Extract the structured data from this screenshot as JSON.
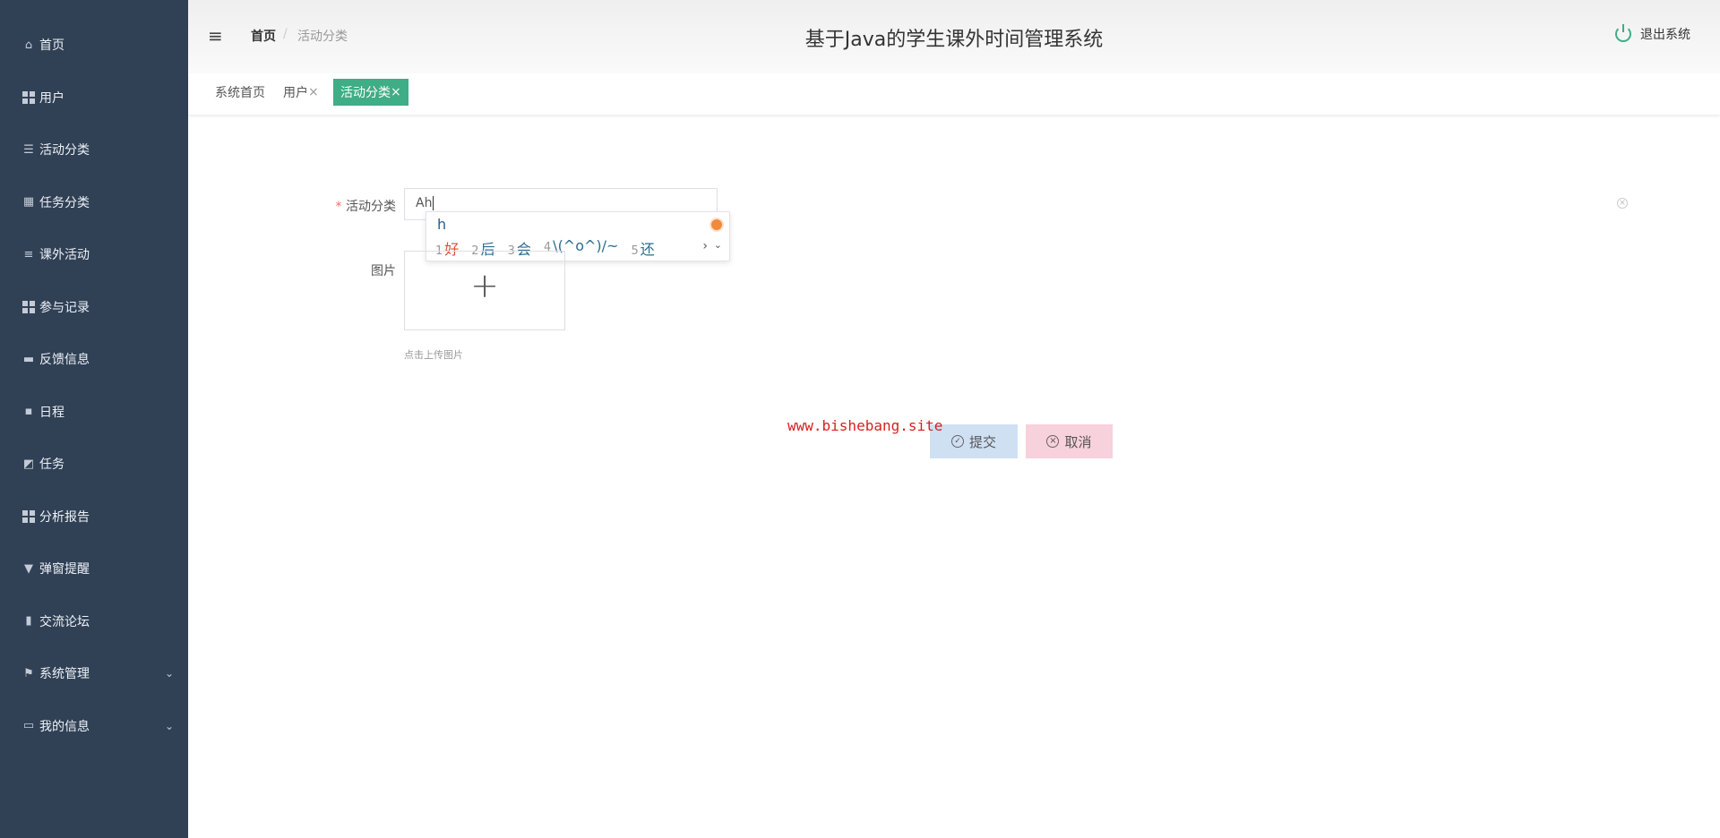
{
  "sidebar": {
    "items": [
      {
        "label": "首页",
        "icon": "home-icon"
      },
      {
        "label": "用户",
        "icon": "grid-icon"
      },
      {
        "label": "活动分类",
        "icon": "sliders-icon"
      },
      {
        "label": "任务分类",
        "icon": "table-icon"
      },
      {
        "label": "课外活动",
        "icon": "list-icon"
      },
      {
        "label": "参与记录",
        "icon": "grid-icon"
      },
      {
        "label": "反馈信息",
        "icon": "printer-icon"
      },
      {
        "label": "日程",
        "icon": "comment-icon"
      },
      {
        "label": "任务",
        "icon": "chart-icon"
      },
      {
        "label": "分析报告",
        "icon": "grid-icon"
      },
      {
        "label": "弹窗提醒",
        "icon": "bell-icon"
      },
      {
        "label": "交流论坛",
        "icon": "clipboard-icon"
      },
      {
        "label": "系统管理",
        "icon": "flag-icon"
      },
      {
        "label": "我的信息",
        "icon": "card-icon"
      }
    ]
  },
  "header": {
    "title": "基于Java的学生课外时间管理系统",
    "breadcrumb": [
      "首页",
      "活动分类"
    ],
    "logout": "退出系统"
  },
  "tabs": [
    {
      "label": "系统首页"
    },
    {
      "label": "用户",
      "close": "×"
    },
    {
      "label": "活动分类",
      "close": "×"
    }
  ],
  "form": {
    "category_label": "活动分类",
    "required_mark": "*",
    "category_value": "Ah",
    "image_label": "图片",
    "upload_plus": "+",
    "upload_hint": "点击上传图片",
    "submit": "提交",
    "cancel": "取消"
  },
  "ime": {
    "composition": "h",
    "candidates": [
      {
        "n": "1",
        "t": "好"
      },
      {
        "n": "2",
        "t": "后"
      },
      {
        "n": "3",
        "t": "会"
      },
      {
        "n": "4",
        "t": "\\(^o^)/~"
      },
      {
        "n": "5",
        "t": "还"
      }
    ]
  },
  "watermark": "www.bishebang.site",
  "colors": {
    "sidebar": "#304156",
    "accent": "#3fad85",
    "submit_bg": "#cfe0f3",
    "cancel_bg": "#f7d1db"
  }
}
